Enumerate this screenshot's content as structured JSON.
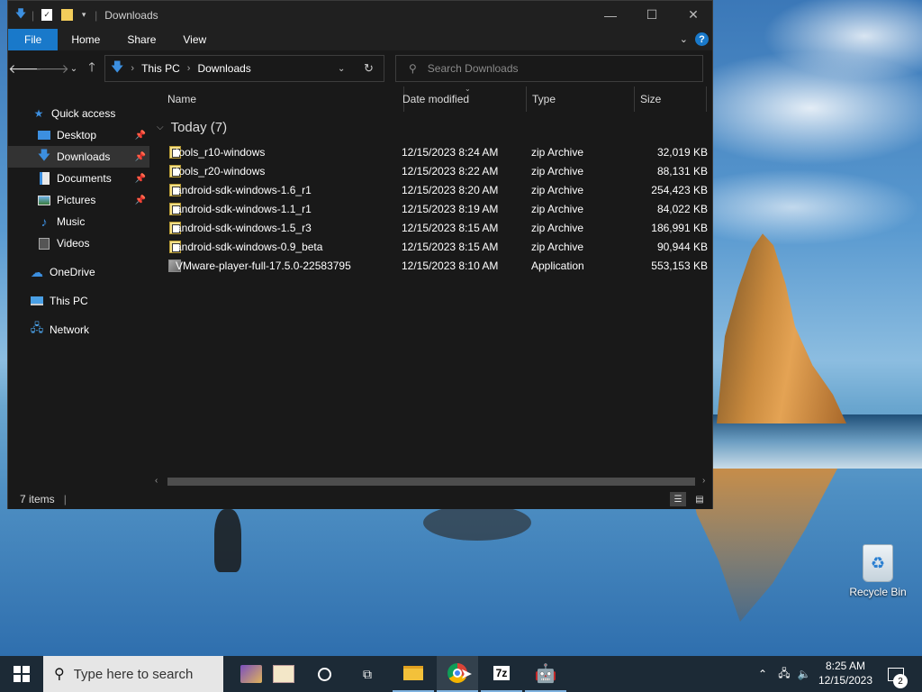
{
  "window": {
    "title": "Downloads",
    "controls": {
      "minimize": "—",
      "maximize": "☐",
      "close": "✕"
    }
  },
  "ribbon": {
    "tabs": [
      "File",
      "Home",
      "Share",
      "View"
    ],
    "help": "?"
  },
  "navigation": {
    "path": [
      "This PC",
      "Downloads"
    ],
    "search_placeholder": "Search Downloads"
  },
  "sidebar": {
    "quick_access": "Quick access",
    "items": [
      {
        "label": "Desktop",
        "icon": "desktop-icon",
        "pinned": true
      },
      {
        "label": "Downloads",
        "icon": "download-folder-icon",
        "pinned": true,
        "active": true
      },
      {
        "label": "Documents",
        "icon": "documents-icon",
        "pinned": true
      },
      {
        "label": "Pictures",
        "icon": "pictures-icon",
        "pinned": true
      },
      {
        "label": "Music",
        "icon": "music-icon",
        "pinned": false
      },
      {
        "label": "Videos",
        "icon": "videos-icon",
        "pinned": false
      }
    ],
    "onedrive": "OneDrive",
    "this_pc": "This PC",
    "network": "Network"
  },
  "columns": {
    "name": "Name",
    "date": "Date modified",
    "type": "Type",
    "size": "Size"
  },
  "group": {
    "label": "Today (7)"
  },
  "files": [
    {
      "name": "tools_r10-windows",
      "date": "12/15/2023 8:24 AM",
      "type": "zip Archive",
      "size": "32,019 KB",
      "icon": "zip-icon"
    },
    {
      "name": "tools_r20-windows",
      "date": "12/15/2023 8:22 AM",
      "type": "zip Archive",
      "size": "88,131 KB",
      "icon": "zip-icon"
    },
    {
      "name": "android-sdk-windows-1.6_r1",
      "date": "12/15/2023 8:20 AM",
      "type": "zip Archive",
      "size": "254,423 KB",
      "icon": "zip-icon"
    },
    {
      "name": "android-sdk-windows-1.1_r1",
      "date": "12/15/2023 8:19 AM",
      "type": "zip Archive",
      "size": "84,022 KB",
      "icon": "zip-icon"
    },
    {
      "name": "android-sdk-windows-1.5_r3",
      "date": "12/15/2023 8:15 AM",
      "type": "zip Archive",
      "size": "186,991 KB",
      "icon": "zip-icon"
    },
    {
      "name": "android-sdk-windows-0.9_beta",
      "date": "12/15/2023 8:15 AM",
      "type": "zip Archive",
      "size": "90,944 KB",
      "icon": "zip-icon"
    },
    {
      "name": "VMware-player-full-17.5.0-22583795",
      "date": "12/15/2023 8:10 AM",
      "type": "Application",
      "size": "553,153 KB",
      "icon": "application-icon"
    }
  ],
  "status": {
    "count": "7 items"
  },
  "desktop": {
    "recycle_bin": "Recycle Bin"
  },
  "taskbar": {
    "search_placeholder": "Type here to search",
    "seven_zip": "7z",
    "clock_time": "8:25 AM",
    "clock_date": "12/15/2023",
    "notification_count": "2"
  },
  "colors": {
    "accent": "#1979ca",
    "window_bg": "#191919",
    "taskbar_bg": "#1c2a36"
  }
}
